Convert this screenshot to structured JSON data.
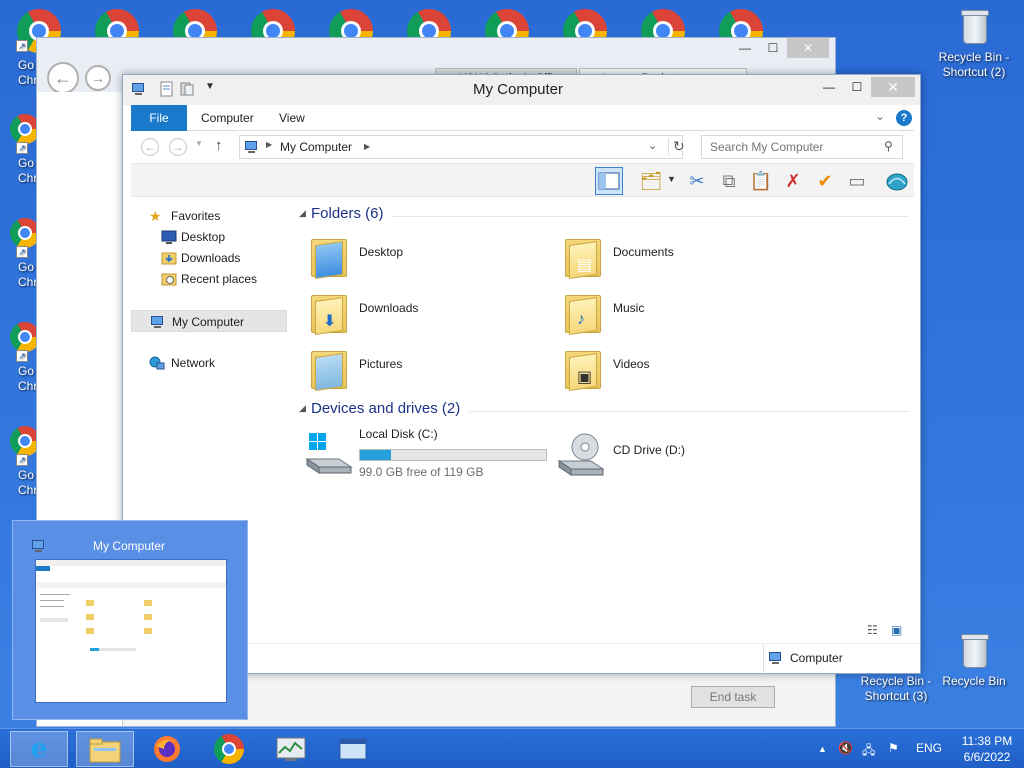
{
  "desktop": {
    "left_icon_label": "Go\nChro",
    "right_icons": [
      {
        "label": "Recycle Bin -\nShortcut (2)",
        "icon": "recycle-bin-icon"
      },
      {
        "label": "Recycle Bin -\nShortcut (3)",
        "icon": "recycle-bin-icon"
      },
      {
        "label": "Recycle Bin",
        "icon": "recycle-bin-icon"
      }
    ]
  },
  "background_window": {
    "end_task_label": "End task",
    "tab_1": "MSN | Outlook, Office",
    "tab_2": "Loans - Bankrate"
  },
  "explorer": {
    "title": "My Computer",
    "ribbon_tabs": {
      "file": "File",
      "computer": "Computer",
      "view": "View"
    },
    "address": {
      "path_label": "My Computer",
      "search_placeholder": "Search My Computer"
    },
    "nav": {
      "favorites": "Favorites",
      "desktop": "Desktop",
      "downloads": "Downloads",
      "recent_places": "Recent places",
      "my_computer": "My Computer",
      "network": "Network"
    },
    "sections": {
      "folders_header": "Folders (6)",
      "devices_header": "Devices and drives (2)"
    },
    "folders": [
      {
        "label": "Desktop",
        "icon": "desktop-folder-icon"
      },
      {
        "label": "Documents",
        "icon": "documents-folder-icon"
      },
      {
        "label": "Downloads",
        "icon": "downloads-folder-icon"
      },
      {
        "label": "Music",
        "icon": "music-folder-icon"
      },
      {
        "label": "Pictures",
        "icon": "pictures-folder-icon"
      },
      {
        "label": "Videos",
        "icon": "videos-folder-icon"
      }
    ],
    "drives": {
      "local_disk": {
        "label": "Local Disk (C:)",
        "free_text": "99.0 GB free of 119 GB",
        "used_fraction": 0.168
      },
      "cd_drive": {
        "label": "CD Drive (D:)"
      }
    },
    "status": {
      "location": "Computer"
    }
  },
  "thumbnail": {
    "title": "My Computer"
  },
  "taskbar": {
    "items": [
      {
        "name": "internet-explorer",
        "icon": "internet-explorer-icon"
      },
      {
        "name": "file-explorer",
        "icon": "file-explorer-icon"
      },
      {
        "name": "firefox",
        "icon": "firefox-icon"
      },
      {
        "name": "chrome",
        "icon": "chrome-icon"
      },
      {
        "name": "task-manager",
        "icon": "task-manager-icon"
      },
      {
        "name": "remote-desktop",
        "icon": "window-icon"
      }
    ],
    "lang": "ENG",
    "time": "11:38 PM",
    "date": "6/6/2022"
  },
  "colors": {
    "accent": "#1979ca",
    "desktop": "#2f73dc",
    "drive_bar": "#26a0da"
  }
}
